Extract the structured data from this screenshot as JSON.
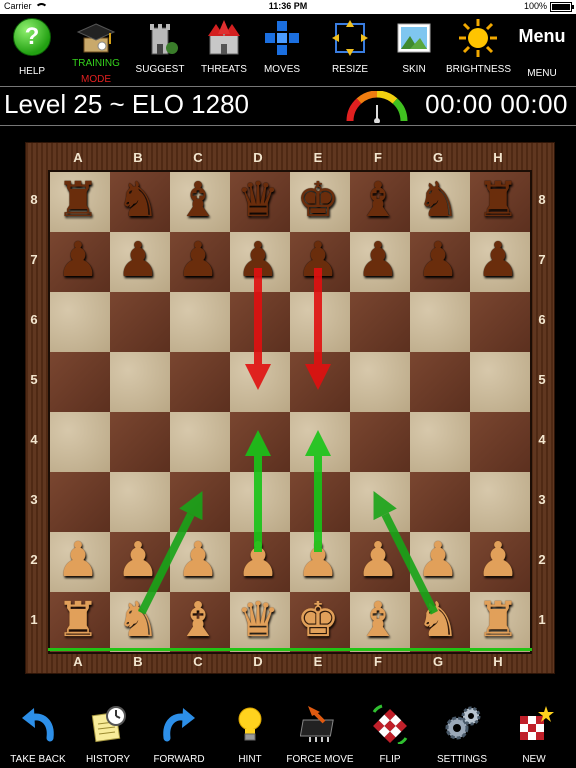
{
  "status": {
    "carrier": "Carrier",
    "time": "11:36 PM",
    "battery": "100%"
  },
  "toolbar": {
    "help": "HELP",
    "training_line1": "TRAINING",
    "training_line2": "MODE",
    "suggest": "SUGGEST",
    "threats": "THREATS",
    "moves": "MOVES",
    "resize": "RESIZE",
    "skin": "SKIN",
    "brightness": "BRIGHTNESS",
    "menu_label": "MENU",
    "menu_icon_text": "Menu",
    "help_icon_text": "?"
  },
  "game": {
    "level": "Level 25 ~ ELO 1280",
    "timer": "00:00 00:00"
  },
  "board": {
    "files": [
      "A",
      "B",
      "C",
      "D",
      "E",
      "F",
      "G",
      "H"
    ],
    "ranks": [
      "8",
      "7",
      "6",
      "5",
      "4",
      "3",
      "2",
      "1"
    ],
    "position": [
      [
        "r",
        "n",
        "b",
        "q",
        "k",
        "b",
        "n",
        "r"
      ],
      [
        "p",
        "p",
        "p",
        "p",
        "p",
        "p",
        "p",
        "p"
      ],
      [
        "",
        "",
        "",
        "",
        "",
        "",
        "",
        ""
      ],
      [
        "",
        "",
        "",
        "",
        "",
        "",
        "",
        ""
      ],
      [
        "",
        "",
        "",
        "",
        "",
        "",
        "",
        ""
      ],
      [
        "",
        "",
        "",
        "",
        "",
        "",
        "",
        ""
      ],
      [
        "P",
        "P",
        "P",
        "P",
        "P",
        "P",
        "P",
        "P"
      ],
      [
        "R",
        "N",
        "B",
        "Q",
        "K",
        "B",
        "N",
        "R"
      ]
    ],
    "arrows": [
      {
        "from": "d7",
        "to": "d5",
        "color": "#e01010"
      },
      {
        "from": "e7",
        "to": "e5",
        "color": "#e01010"
      },
      {
        "from": "d2",
        "to": "d4",
        "color": "#18c418"
      },
      {
        "from": "e2",
        "to": "e4",
        "color": "#18c418"
      },
      {
        "from": "b1",
        "to": "c3",
        "color": "#18a418"
      },
      {
        "from": "g1",
        "to": "f3",
        "color": "#18a418"
      }
    ]
  },
  "bottombar": {
    "take_back": "TAKE BACK",
    "history": "HISTORY",
    "forward": "FORWARD",
    "hint": "HINT",
    "force_move": "FORCE MOVE",
    "flip": "FLIP",
    "settings": "SETTINGS",
    "new": "NEW"
  }
}
